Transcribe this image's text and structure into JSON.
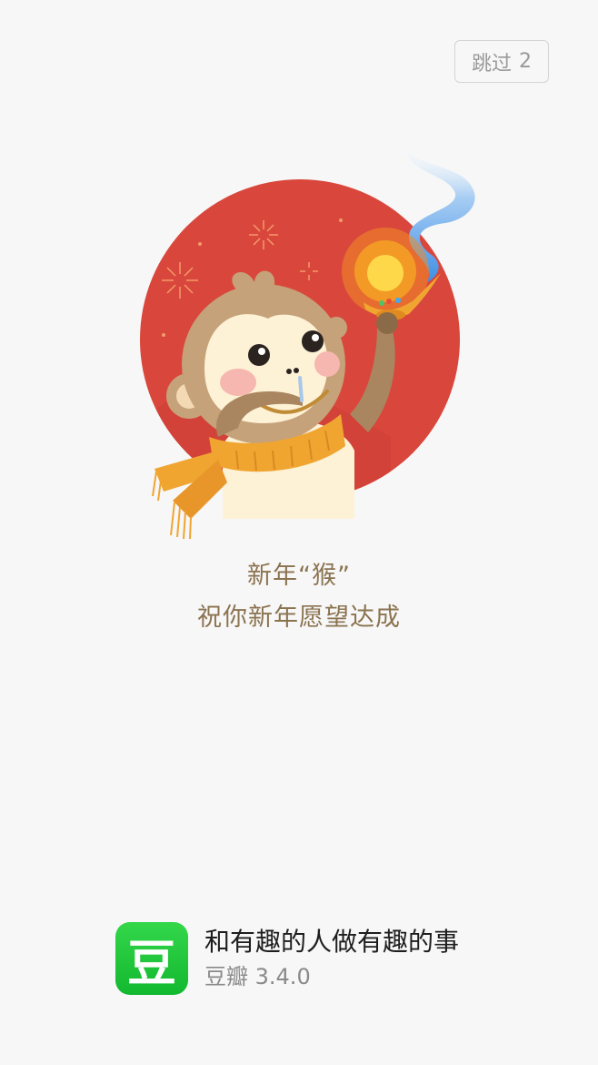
{
  "skip": {
    "label": "跳过",
    "countdown": "2"
  },
  "illustration": {
    "description_icon": "monkey-with-lamp-illustration"
  },
  "greeting": {
    "line1": "新年“猴”",
    "line2": "祝你新年愿望达成"
  },
  "footer": {
    "logo_char": "豆",
    "slogan": "和有趣的人做有趣的事",
    "app_name": "豆瓣",
    "version": "3.4.0"
  },
  "colors": {
    "background": "#f7f7f7",
    "red_circle": "#d9473c",
    "greeting_text": "#8b7350",
    "logo_green": "#1fc63a",
    "scarf": "#f0a531"
  }
}
